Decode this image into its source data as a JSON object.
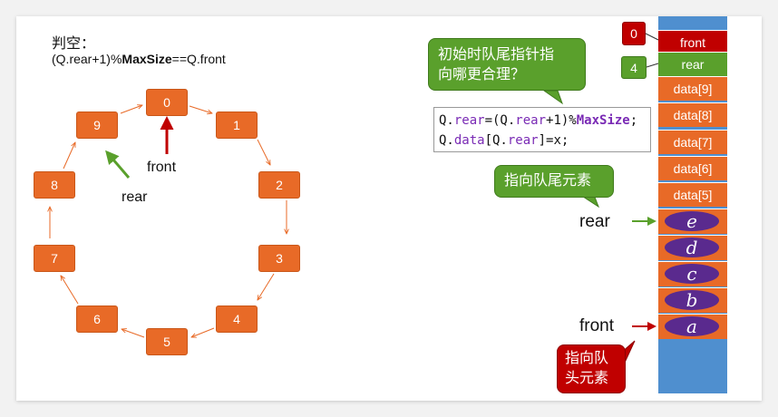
{
  "heading": "判空：",
  "formula": {
    "pre": "(Q.rear+1)%",
    "bold": "MaxSize",
    "post": "==Q.front"
  },
  "ring": {
    "nodes": [
      "0",
      "1",
      "2",
      "3",
      "4",
      "5",
      "6",
      "7",
      "8",
      "9"
    ],
    "front_label": "front",
    "rear_label": "rear"
  },
  "callout_top": {
    "line1": "初始时队尾指针指",
    "line2": "向哪更合理？"
  },
  "code": {
    "line1": [
      "Q.",
      "rear",
      "=(Q.",
      "rear",
      "+1)%",
      "MaxSize",
      ";"
    ],
    "line2": [
      "Q.",
      "data",
      "[Q.",
      "rear",
      "]=x;"
    ]
  },
  "callout_tail": "指向队尾元素",
  "callout_head": {
    "line1": "指向队",
    "line2": "头元素"
  },
  "queue": {
    "front_cell": "front",
    "rear_cell": "rear",
    "front_index": "0",
    "rear_index": "4",
    "data_cells": [
      "data[9]",
      "data[8]",
      "data[7]",
      "data[6]",
      "data[5]"
    ],
    "elements": [
      "e",
      "d",
      "c",
      "b",
      "a"
    ],
    "rear_pointer": "rear",
    "front_pointer": "front"
  },
  "colors": {
    "orange": "#e86a27",
    "green": "#5aa02c",
    "red": "#c00000",
    "purple": "#5a2a8e",
    "blue": "#4f8fcf"
  }
}
